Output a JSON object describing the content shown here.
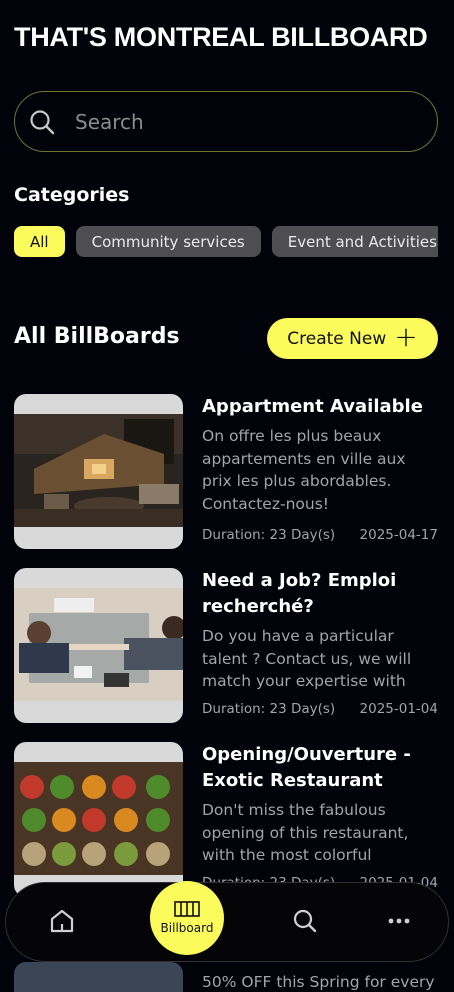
{
  "app": {
    "title": "THAT'S MONTREAL BILLBOARD"
  },
  "search": {
    "placeholder": "Search"
  },
  "categories": {
    "title": "Categories",
    "items": [
      {
        "label": "All",
        "active": true
      },
      {
        "label": "Community services",
        "active": false
      },
      {
        "label": "Event and Activities",
        "active": false
      }
    ]
  },
  "billboards": {
    "title": "All BillBoards",
    "create_label": "Create New",
    "items": [
      {
        "title": "Appartment Available",
        "description": "On offre les plus beaux appartements en ville aux prix les plus abordables. Contactez-nous!",
        "duration": "Duration: 23 Day(s)",
        "date": "2025-04-17"
      },
      {
        "title": "Need a Job? Emploi recherché?",
        "description": "Do you have a particular talent ? Contact us, we will match your expertise with",
        "duration": "Duration: 23 Day(s)",
        "date": "2025-01-04"
      },
      {
        "title": "Opening/Ouverture - Exotic Restaurant",
        "description": "Don't miss the fabulous opening of this restaurant, with the most colorful",
        "duration": "Duration: 23 Day(s)",
        "date": "2025-01-04"
      }
    ],
    "peek_description": "50% OFF this Spring for every"
  },
  "nav": {
    "items": [
      {
        "icon": "home-icon"
      },
      {
        "icon": "billboard-icon",
        "label": "Billboard",
        "active": true
      },
      {
        "icon": "search-icon"
      },
      {
        "icon": "more-icon"
      }
    ]
  },
  "colors": {
    "accent": "#fbfb5b",
    "background": "#02030a",
    "chip": "#4e4e52",
    "muted_text": "#a4a4a8"
  }
}
